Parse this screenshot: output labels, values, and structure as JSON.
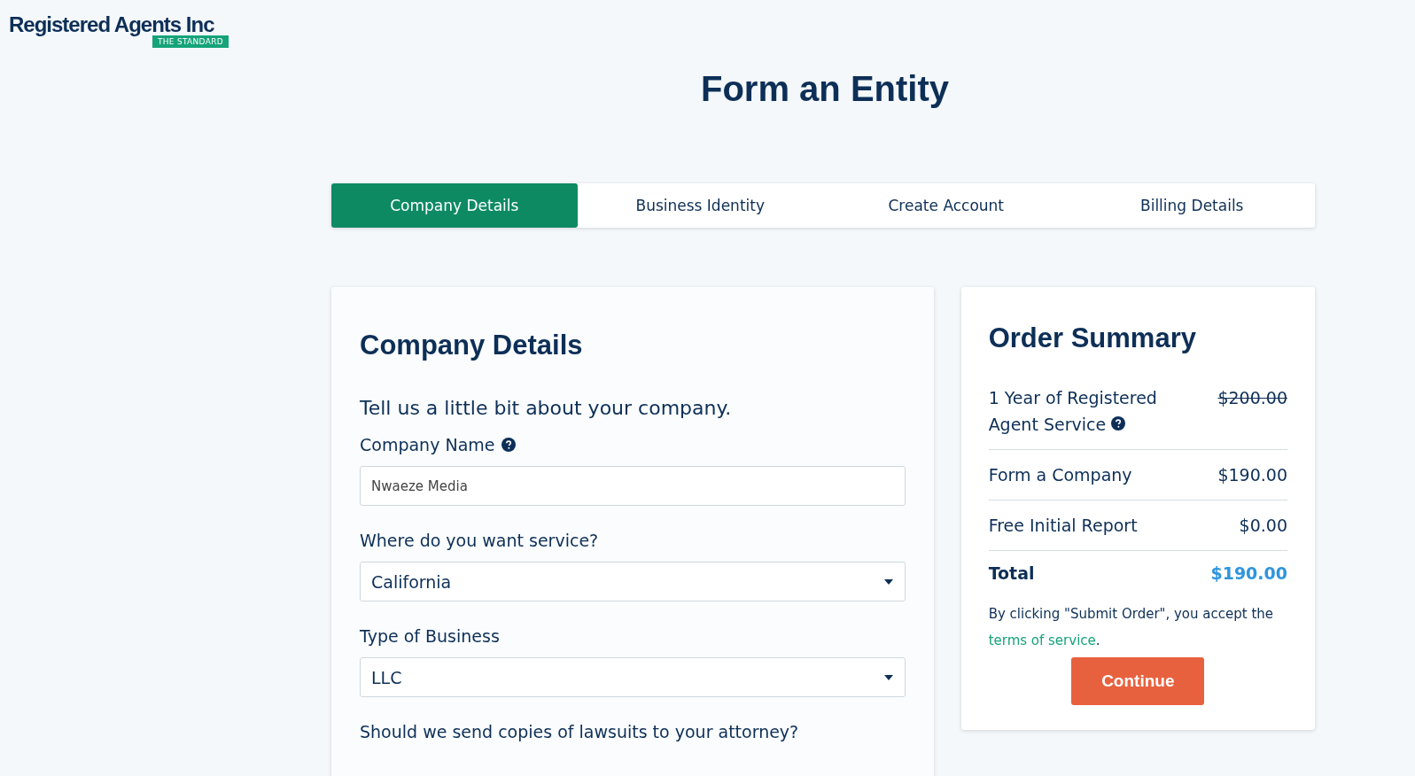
{
  "logo": {
    "name": "Registered Agents Inc",
    "tagline": "THE STANDARD"
  },
  "page_title": "Form an Entity",
  "steps": [
    {
      "label": "Company Details",
      "selected": true
    },
    {
      "label": "Business Identity",
      "selected": false
    },
    {
      "label": "Create Account",
      "selected": false
    },
    {
      "label": "Billing Details",
      "selected": false
    }
  ],
  "form": {
    "heading": "Company Details",
    "intro": "Tell us a little bit about your company.",
    "fields": [
      {
        "kind": "text",
        "label": "Company Name",
        "help": true,
        "value": "Nwaeze Media"
      },
      {
        "kind": "select",
        "label": "Where do you want service?",
        "help": false,
        "value": "California"
      },
      {
        "kind": "select",
        "label": "Type of Business",
        "help": false,
        "value": "LLC"
      },
      {
        "kind": "question",
        "label": "Should we send copies of lawsuits to your attorney?",
        "help": false
      }
    ]
  },
  "summary": {
    "heading": "Order Summary",
    "items": [
      {
        "label": "1 Year of Registered Agent Service",
        "help": true,
        "price": "$200.00",
        "struck": true
      },
      {
        "label": "Form a Company",
        "help": false,
        "price": "$190.00",
        "struck": false
      },
      {
        "label": "Free Initial Report",
        "help": false,
        "price": "$0.00",
        "struck": false
      }
    ],
    "total_label": "Total",
    "total": "$190.00",
    "note": "By clicking \"Submit Order\", you accept the",
    "terms_link": "terms of service",
    "note_end": ".",
    "button": "Continue"
  }
}
